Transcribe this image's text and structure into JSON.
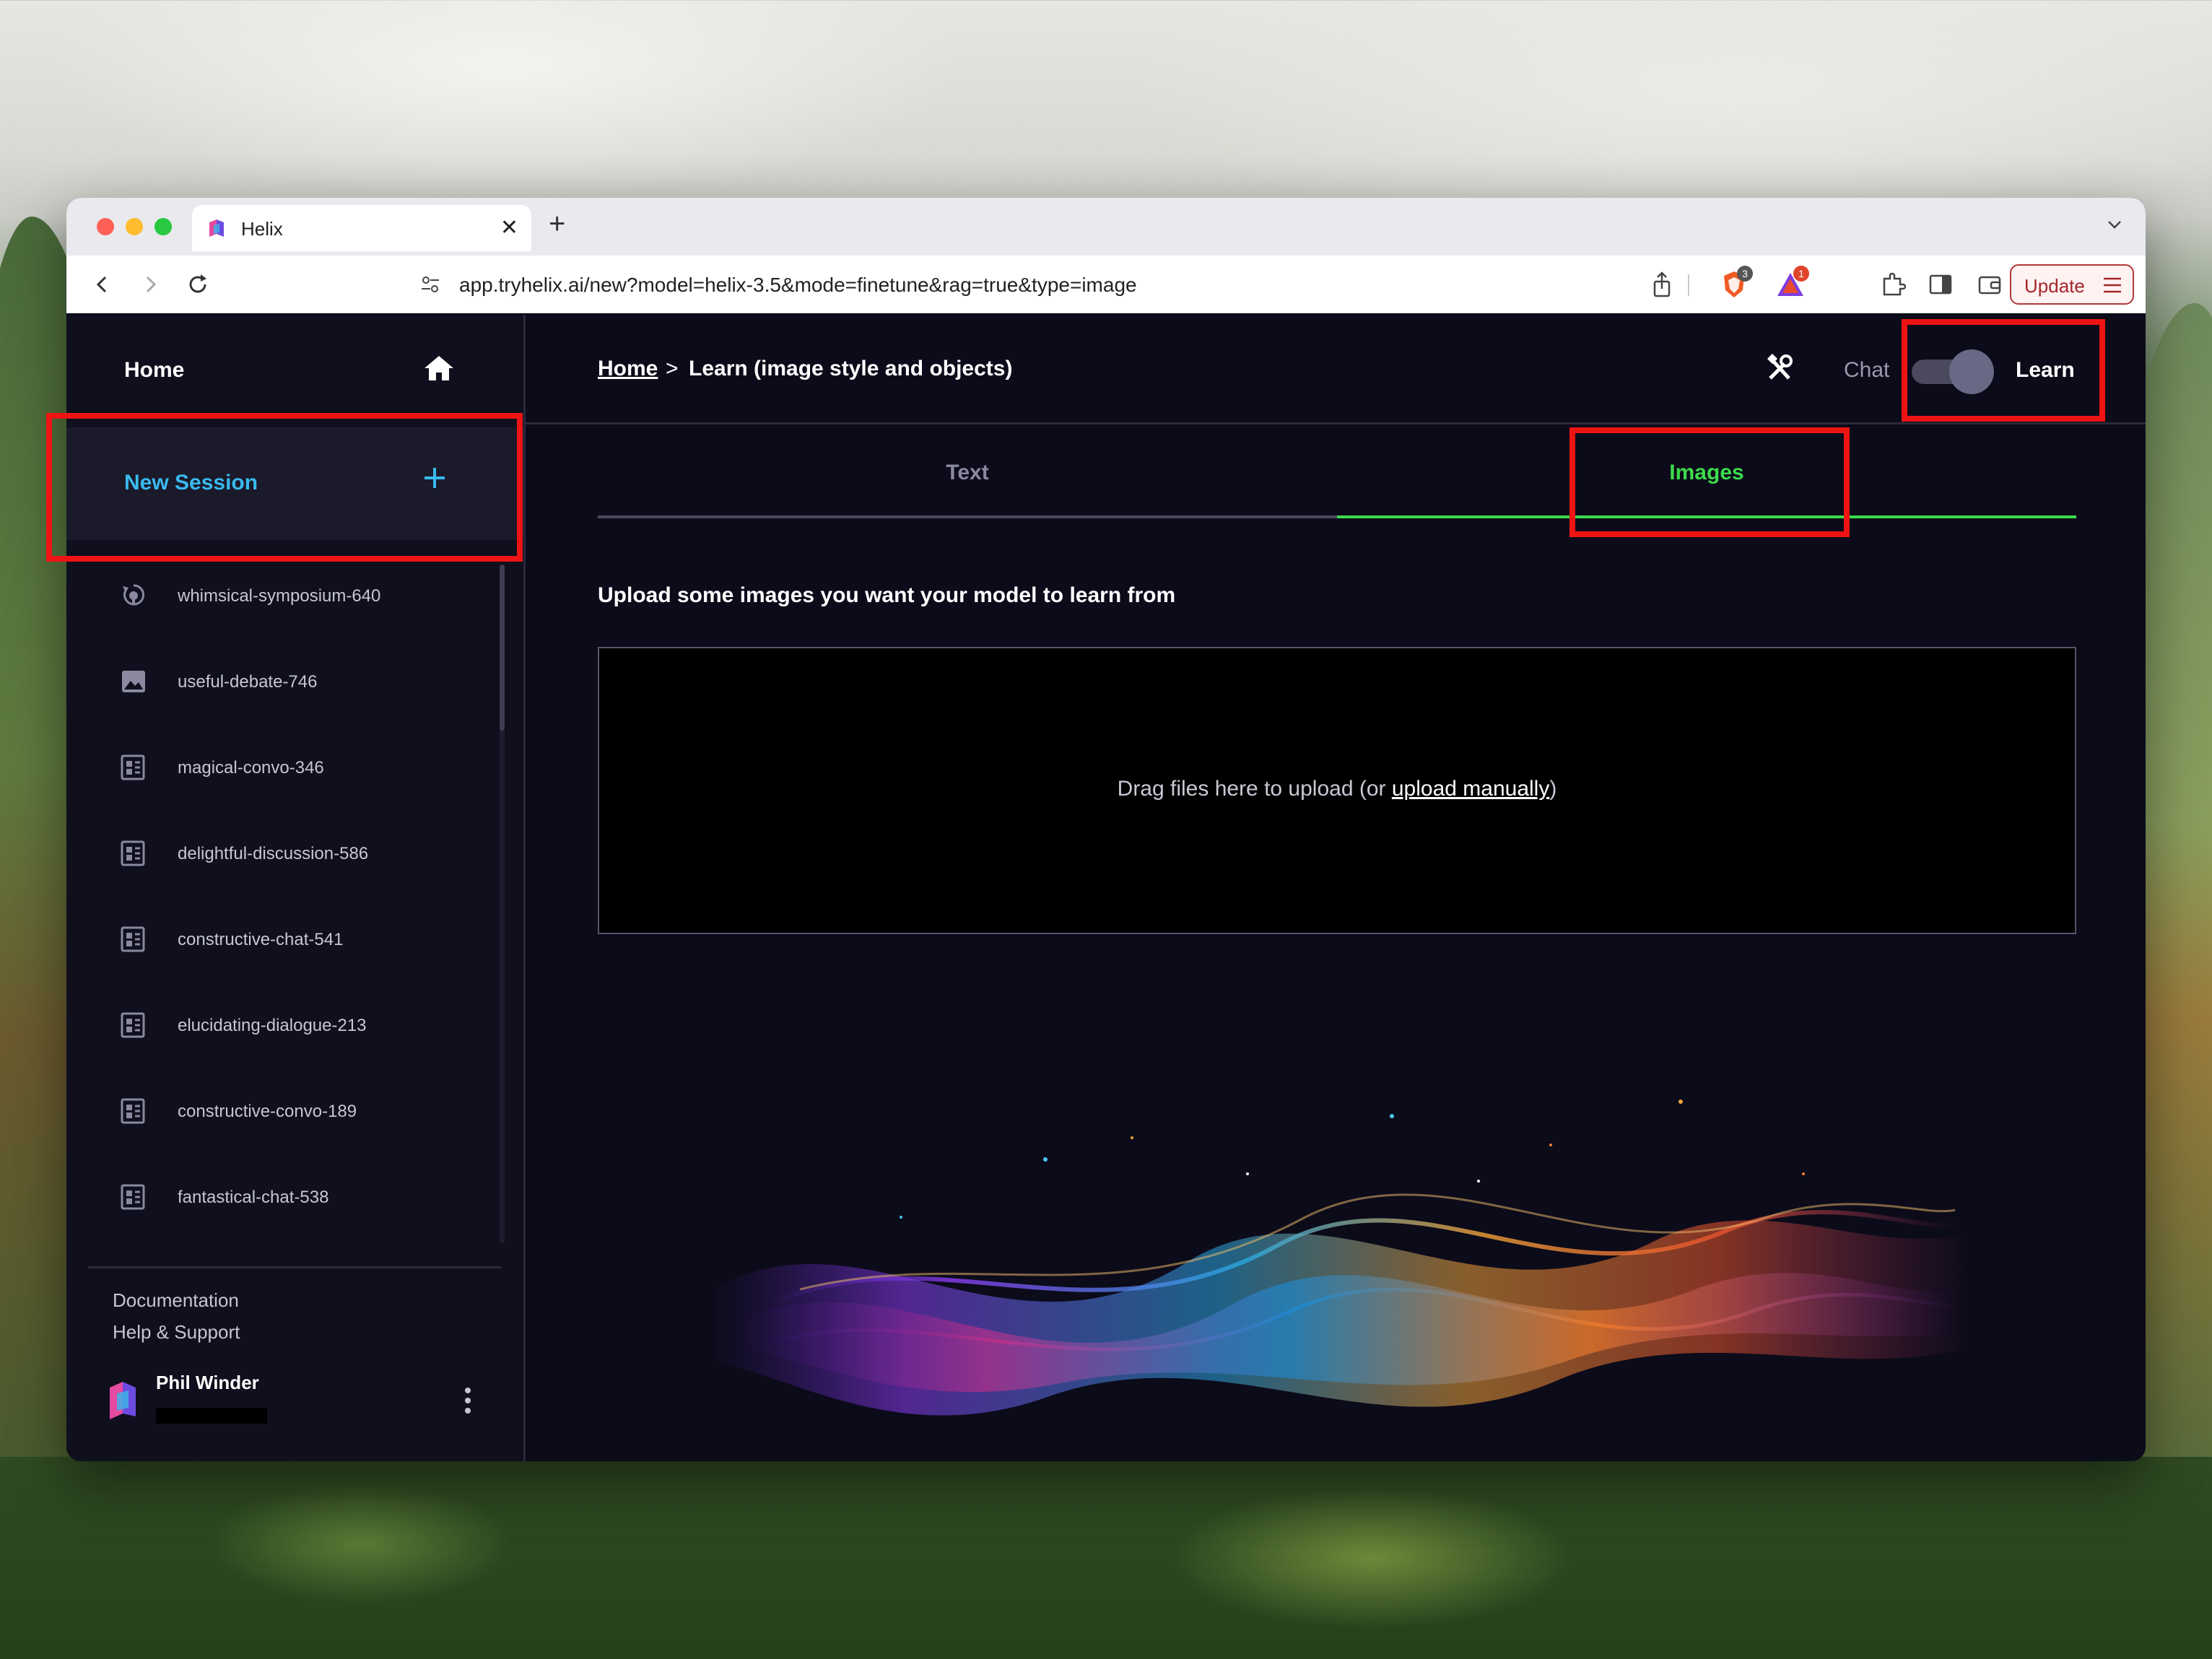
{
  "browser": {
    "tab_title": "Helix",
    "tab_close": "✕",
    "new_tab": "+",
    "url": "app.tryhelix.ai/new?model=helix-3.5&mode=finetune&rag=true&type=image",
    "shield_badge": "3",
    "rewards_badge": "1",
    "update_label": "Update"
  },
  "sidebar": {
    "home_label": "Home",
    "new_session_label": "New Session",
    "sessions": [
      {
        "label": "whimsical-symposium-640",
        "icon": "finetune-icon"
      },
      {
        "label": "useful-debate-746",
        "icon": "image-icon"
      },
      {
        "label": "magical-convo-346",
        "icon": "text-doc-icon"
      },
      {
        "label": "delightful-discussion-586",
        "icon": "text-doc-icon"
      },
      {
        "label": "constructive-chat-541",
        "icon": "text-doc-icon"
      },
      {
        "label": "elucidating-dialogue-213",
        "icon": "text-doc-icon"
      },
      {
        "label": "constructive-convo-189",
        "icon": "text-doc-icon"
      },
      {
        "label": "fantastical-chat-538",
        "icon": "text-doc-icon"
      }
    ],
    "documentation_label": "Documentation",
    "help_label": "Help & Support",
    "user_name": "Phil Winder"
  },
  "topbar": {
    "crumb_home": "Home",
    "crumb_sep": ">",
    "crumb_page": "Learn (image style and objects)",
    "chat_label": "Chat",
    "learn_label": "Learn",
    "mode_learn_active": true
  },
  "tabs": {
    "text_label": "Text",
    "images_label": "Images",
    "active": "Images"
  },
  "upload": {
    "heading": "Upload some images you want your model to learn from",
    "drop_text_before": "Drag files here to upload (or ",
    "drop_link": "upload manually",
    "drop_text_after": ")"
  },
  "colors": {
    "accent_active_tab": "#3ddc4b",
    "new_session_text": "#38b9ee",
    "highlight_box": "#ee1414",
    "app_background": "#0c0b1a"
  }
}
